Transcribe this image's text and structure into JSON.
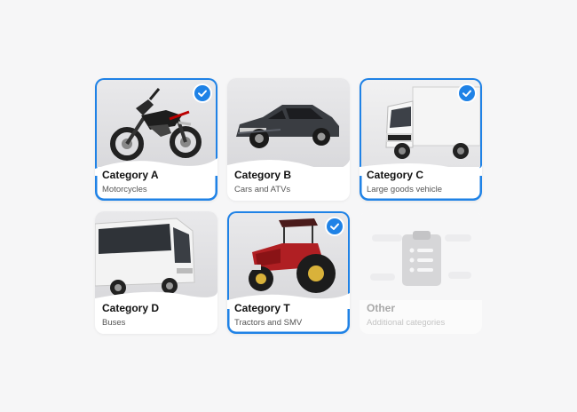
{
  "categories": [
    {
      "title": "Category A",
      "subtitle": "Motorcycles",
      "selected": true,
      "icon": "motorcycle-icon"
    },
    {
      "title": "Category B",
      "subtitle": "Cars and ATVs",
      "selected": false,
      "icon": "car-icon"
    },
    {
      "title": "Category C",
      "subtitle": "Large goods vehicle",
      "selected": true,
      "icon": "truck-icon"
    },
    {
      "title": "Category D",
      "subtitle": "Buses",
      "selected": false,
      "icon": "bus-icon"
    },
    {
      "title": "Category T",
      "subtitle": "Tractors and SMV",
      "selected": true,
      "icon": "tractor-icon"
    },
    {
      "title": "Other",
      "subtitle": "Additional categories",
      "selected": false,
      "icon": "clipboard-list-icon"
    }
  ],
  "colors": {
    "accent": "#1f82e6",
    "background": "#f6f6f7",
    "card": "#ffffff"
  }
}
